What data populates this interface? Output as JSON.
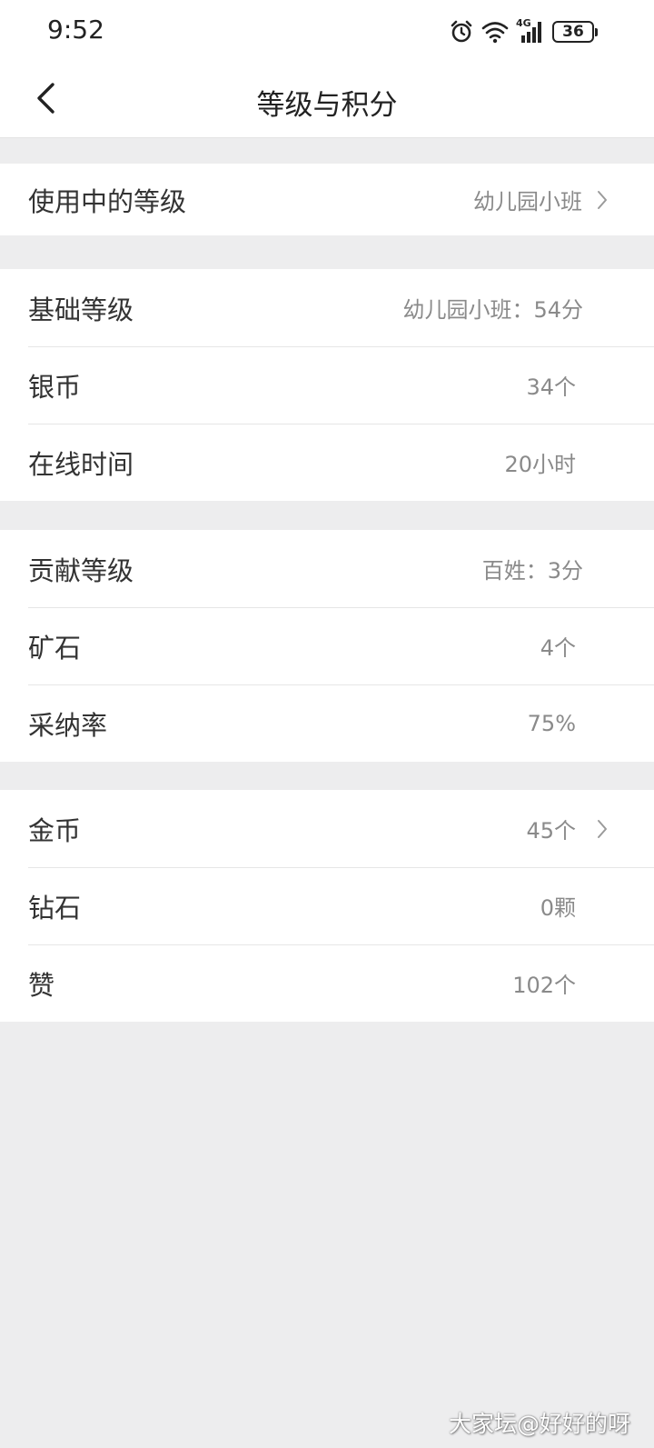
{
  "status_bar": {
    "time": "9:52",
    "network_label": "4G",
    "battery_level": "36",
    "icons": [
      "alarm-icon",
      "wifi-icon",
      "cellular-signal-icon",
      "battery-icon"
    ]
  },
  "nav": {
    "title": "等级与积分",
    "back_icon": "chevron-left-icon"
  },
  "sections": [
    {
      "rows": [
        {
          "label": "使用中的等级",
          "value": "幼儿园小班",
          "has_arrow": true
        }
      ]
    },
    {
      "rows": [
        {
          "label": "基础等级",
          "value": "幼儿园小班：54分",
          "has_arrow": false
        },
        {
          "label": "银币",
          "value": "34个",
          "has_arrow": false
        },
        {
          "label": "在线时间",
          "value": "20小时",
          "has_arrow": false
        }
      ]
    },
    {
      "rows": [
        {
          "label": "贡献等级",
          "value": "百姓：3分",
          "has_arrow": false
        },
        {
          "label": "矿石",
          "value": "4个",
          "has_arrow": false
        },
        {
          "label": "采纳率",
          "value": "75%",
          "has_arrow": false
        }
      ]
    },
    {
      "rows": [
        {
          "label": "金币",
          "value": "45个",
          "has_arrow": true
        },
        {
          "label": "钻石",
          "value": "0颗",
          "has_arrow": false
        },
        {
          "label": "赞",
          "value": "102个",
          "has_arrow": false
        }
      ]
    }
  ],
  "watermark": "大家坛@好好的呀",
  "colors": {
    "background": "#ededee",
    "card": "#ffffff",
    "label_text": "#333333",
    "value_text": "#8a8a8a",
    "divider": "#e6e6e6"
  }
}
